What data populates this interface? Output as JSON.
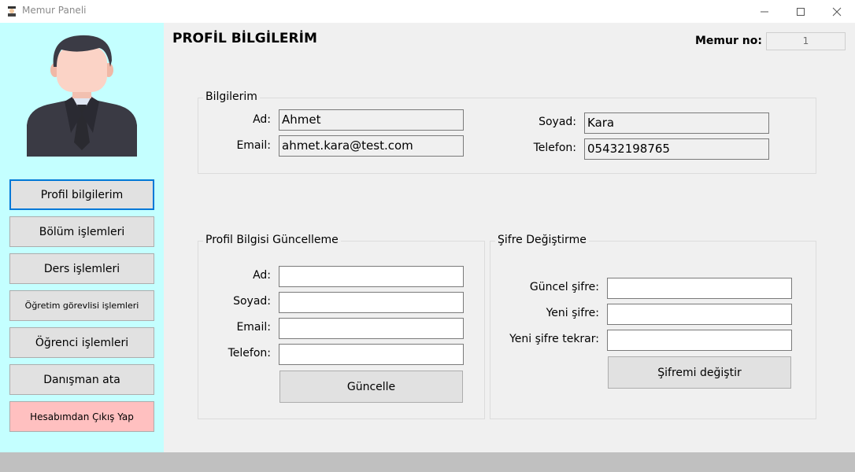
{
  "window": {
    "title": "Memur Paneli"
  },
  "sidebar": {
    "items": [
      {
        "label": "Profil bilgilerim"
      },
      {
        "label": "Bölüm işlemleri"
      },
      {
        "label": "Ders işlemleri"
      },
      {
        "label": "Öğretim görevlisi işlemleri"
      },
      {
        "label": "Öğrenci işlemleri"
      },
      {
        "label": "Danışman ata"
      },
      {
        "label": "Hesabımdan Çıkış Yap"
      }
    ]
  },
  "header": {
    "title": "PROFİL BİLGİLERİM",
    "memur_label": "Memur no:",
    "memur_value": "1"
  },
  "info": {
    "legend": "Bilgilerim",
    "ad_label": "Ad:",
    "ad_value": "Ahmet",
    "email_label": "Email:",
    "email_value": "ahmet.kara@test.com",
    "soyad_label": "Soyad:",
    "soyad_value": "Kara",
    "telefon_label": "Telefon:",
    "telefon_value": "05432198765"
  },
  "update": {
    "legend": "Profil Bilgisi Güncelleme",
    "ad_label": "Ad:",
    "soyad_label": "Soyad:",
    "email_label": "Email:",
    "telefon_label": "Telefon:",
    "button": "Güncelle"
  },
  "password": {
    "legend": "Şifre Değiştirme",
    "current_label": "Güncel şifre:",
    "new_label": "Yeni şifre:",
    "repeat_label": "Yeni şifre tekrar:",
    "button": "Şifremi değiştir"
  },
  "colors": {
    "sidebar_bg": "#c4ffff",
    "logout_bg": "#ffc0c0",
    "active_border": "#0078d7"
  }
}
